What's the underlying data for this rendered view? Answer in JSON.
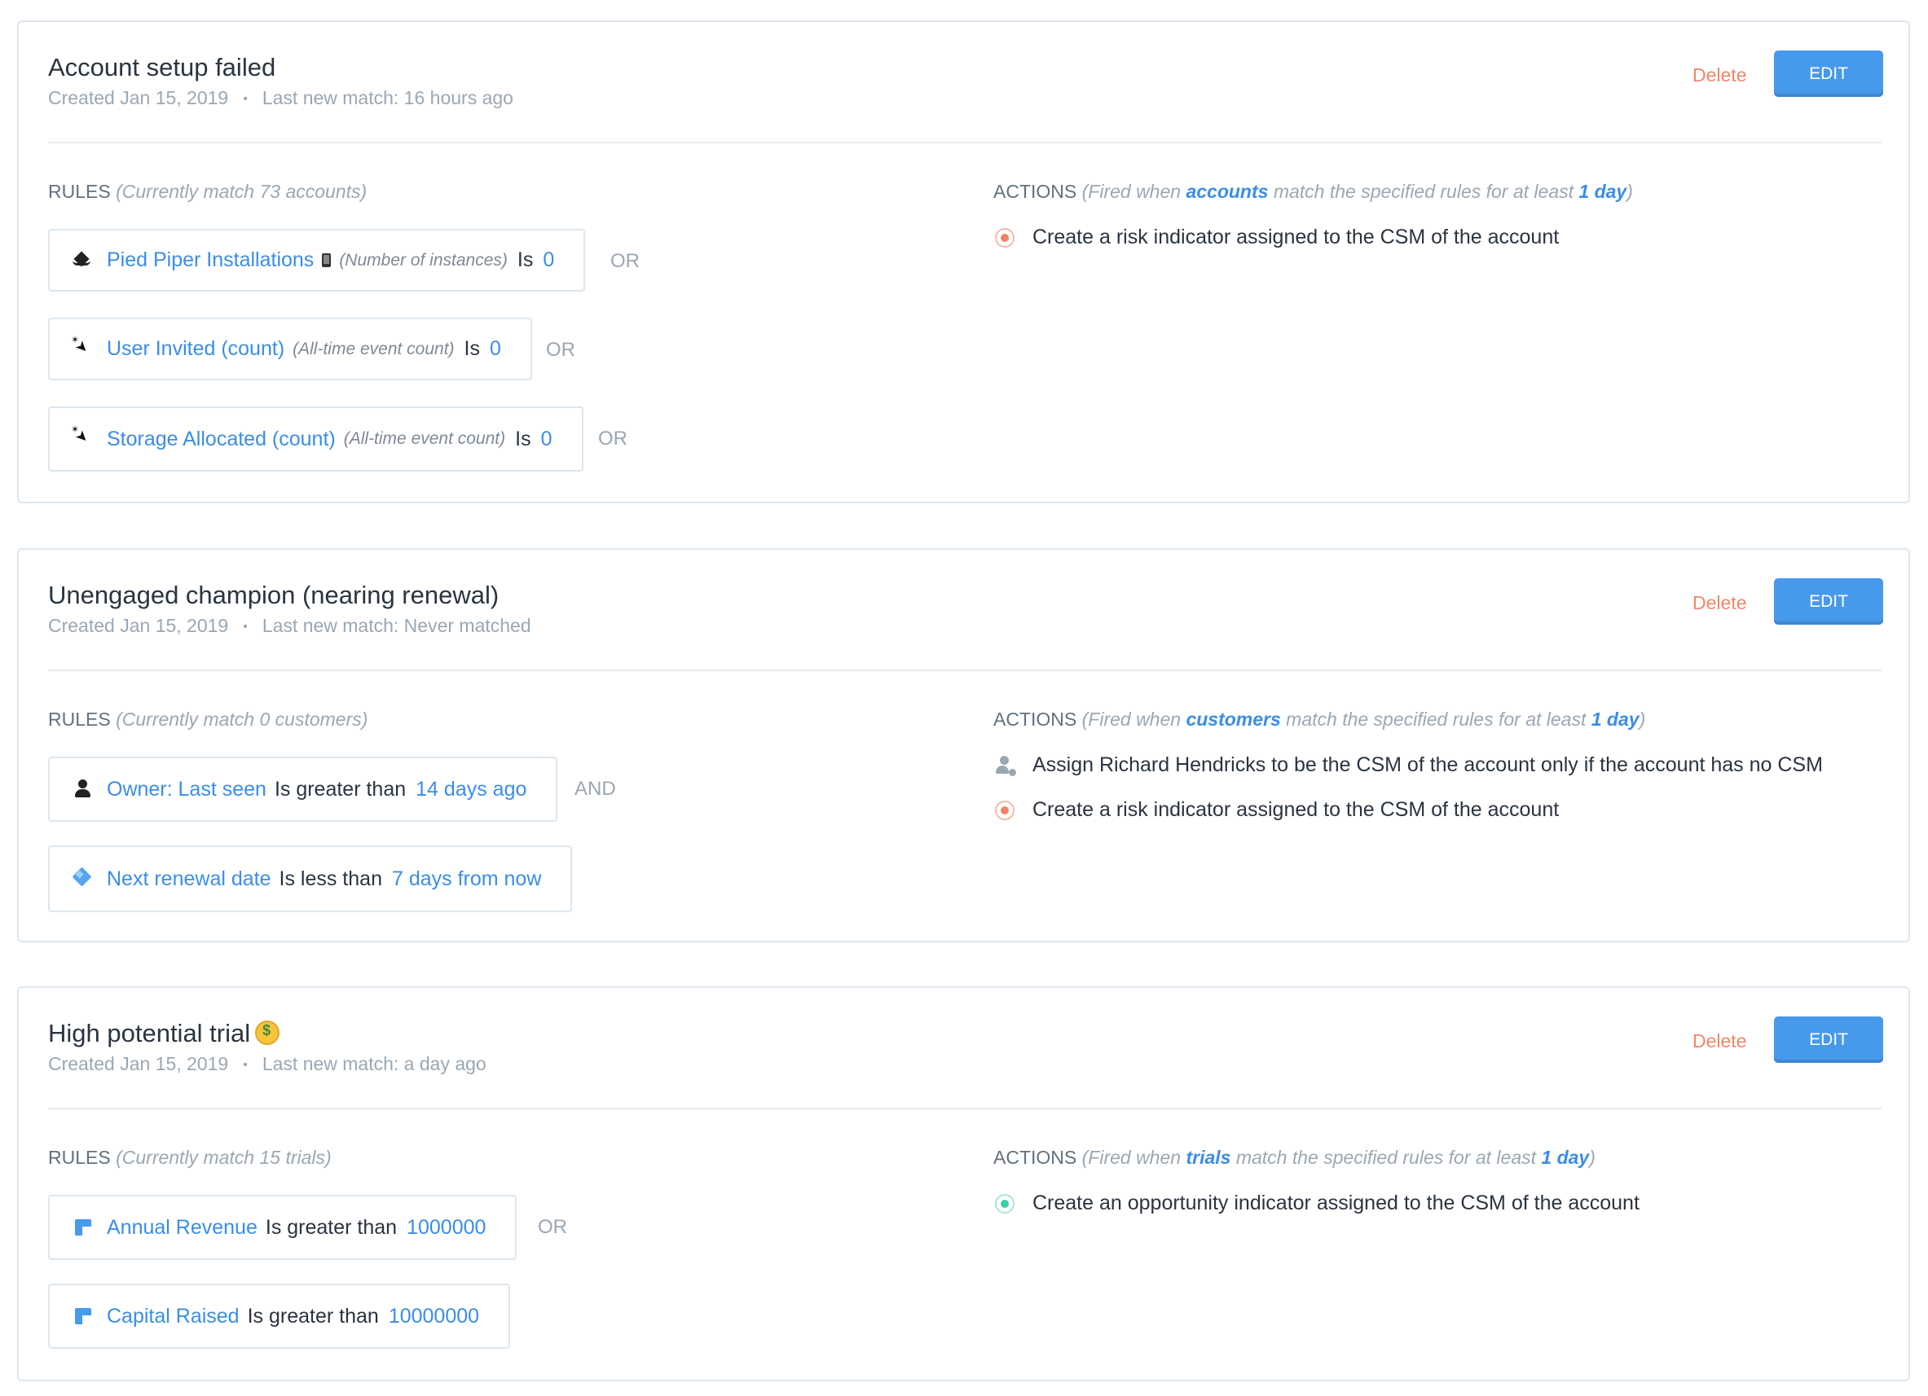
{
  "labels": {
    "delete": "Delete",
    "edit": "EDIT",
    "rules": "RULES",
    "actions": "ACTIONS",
    "fired_when": "(Fired when",
    "match_text": "match the specified rules for at least",
    "close_paren": ")",
    "meta_dot": "•"
  },
  "cards": [
    {
      "title": "Account setup failed",
      "created": "Created Jan 15, 2019",
      "last_match": "Last new match: 16 hours ago",
      "rules_note": "(Currently match 73 accounts)",
      "entity": "accounts",
      "duration": "1 day",
      "rules": [
        {
          "icon": "layers-icon",
          "field": "Pied Piper Installations",
          "device_icon": "mobile-phone-icon",
          "sub": "(Number of instances)",
          "op": "Is",
          "value": "0",
          "connector": "OR"
        },
        {
          "icon": "click-event-icon",
          "field": "User Invited (count)",
          "sub": "(All-time event count)",
          "op": "Is",
          "value": "0",
          "connector": "OR"
        },
        {
          "icon": "click-event-icon",
          "field": "Storage Allocated (count)",
          "sub": "(All-time event count)",
          "op": "Is",
          "value": "0",
          "connector": "OR"
        }
      ],
      "actions": [
        {
          "icon": "risk-indicator-icon",
          "text": "Create a risk indicator assigned to the CSM of the account"
        }
      ]
    },
    {
      "title": "Unengaged champion (nearing renewal)",
      "created": "Created Jan 15, 2019",
      "last_match": "Last new match: Never matched",
      "rules_note": "(Currently match 0 customers)",
      "entity": "customers",
      "duration": "1 day",
      "rules": [
        {
          "icon": "user-icon",
          "field": "Owner: Last seen",
          "op": "Is greater than",
          "value": "14 days ago",
          "connector": "AND"
        },
        {
          "icon": "diamond-icon",
          "field": "Next renewal date",
          "op": "Is less than",
          "value": "7 days from now",
          "connector": ""
        }
      ],
      "actions": [
        {
          "icon": "assign-user-icon",
          "text": "Assign Richard Hendricks to be the CSM of the account only if the account has no CSM"
        },
        {
          "icon": "risk-indicator-icon",
          "text": "Create a risk indicator assigned to the CSM of the account"
        }
      ]
    },
    {
      "title": "High potential trial",
      "title_emoji": "money-mouth-face-emoji",
      "created": "Created Jan 15, 2019",
      "last_match": "Last new match: a day ago",
      "rules_note": "(Currently match 15 trials)",
      "entity": "trials",
      "duration": "1 day",
      "rules": [
        {
          "icon": "custom-field-icon",
          "field": "Annual Revenue",
          "op": "Is greater than",
          "value": "1000000",
          "connector": "OR"
        },
        {
          "icon": "custom-field-icon",
          "field": "Capital Raised",
          "op": "Is greater than",
          "value": "10000000",
          "connector": ""
        }
      ],
      "actions": [
        {
          "icon": "opportunity-indicator-icon",
          "text": "Create an opportunity indicator assigned to the CSM of the account"
        }
      ]
    }
  ],
  "colors": {
    "accent": "#3b8de6",
    "edit_button": "#4799ec",
    "delete": "#f0876a",
    "risk": "#f08467",
    "opportunity": "#3fcda5",
    "border": "#dde6ee"
  }
}
